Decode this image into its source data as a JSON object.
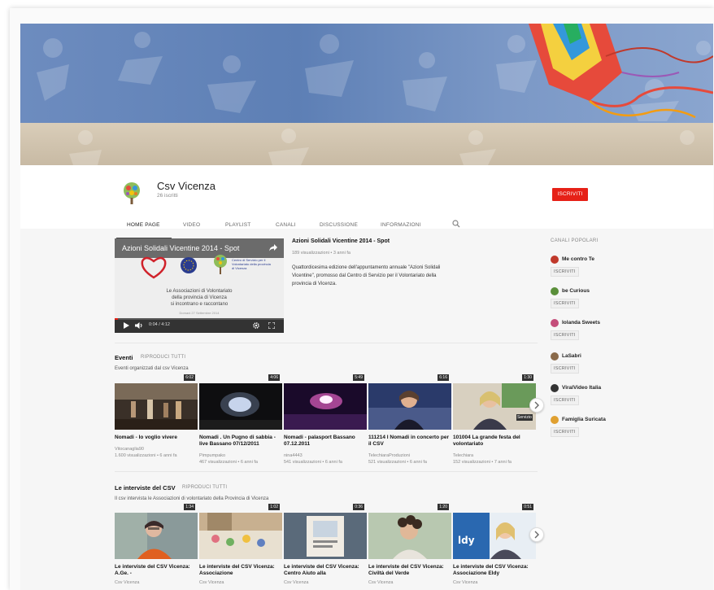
{
  "channel": {
    "name": "Csv Vicenza",
    "subscribers": "26 iscritti",
    "subscribe_label": "ISCRIVITI"
  },
  "tabs": [
    {
      "label": "HOME PAGE",
      "active": true
    },
    {
      "label": "VIDEO"
    },
    {
      "label": "PLAYLIST"
    },
    {
      "label": "CANALI"
    },
    {
      "label": "DISCUSSIONE"
    },
    {
      "label": "INFORMAZIONI"
    }
  ],
  "featured": {
    "player_title": "Azioni Solidali Vicentine 2014 - Spot",
    "player_text": [
      "Le Associazioni di Volontariato",
      "della provincia di Vicenza",
      "si incontrano e raccontano"
    ],
    "player_date": "Domani 27 Settembre 2014",
    "logo_text": "Centro di Servizio per il Volontariato della provincia di Vicenza",
    "time": "0:04 / 4:12",
    "title": "Azioni Solidali Vicentine 2014 - Spot",
    "meta": "189 visualizzazioni • 3 anni fa",
    "description": "Quattordicesima edizione dell'appuntamento annuale \"Azioni Solidali Vicentine\", promosso dal Centro di Servizio per il Volontariato della provincia di Vicenza."
  },
  "shelves": [
    {
      "title": "Eventi",
      "play_all": "RIPRODUCI TUTTI",
      "description": "Eventi organizzati dal csv Vicenza",
      "videos": [
        {
          "title": "Nomadi - Io voglio vivere",
          "channel": "Vitocanaglia90",
          "meta": "1.600 visualizzazioni • 6 anni fa",
          "duration": "6:02",
          "thumb": "concert-stage"
        },
        {
          "title": "Nomadi . Un Pugno di sabbia - live Bassano 07/12/2011",
          "channel": "Pimpumpako",
          "meta": "467 visualizzazioni • 6 anni fa",
          "duration": "4:06",
          "thumb": "dark-stage"
        },
        {
          "title": "Nomadi - palasport Bassano 07.12.2011",
          "channel": "nina4443",
          "meta": "541 visualizzazioni • 6 anni fa",
          "duration": "5:49",
          "thumb": "arena-lights"
        },
        {
          "title": "111214 I Nomadi in concerto per il CSV",
          "channel": "TelechiaraProduzioni",
          "meta": "521 visualizzazioni • 6 anni fa",
          "duration": "6:16",
          "thumb": "interview-woman"
        },
        {
          "title": "101004 La grande festa del volontariato",
          "channel": "Telechiara",
          "meta": "152 visualizzazioni • 7 anni fa",
          "duration": "1:30",
          "thumb": "interview-blonde",
          "badge": "Servizio"
        }
      ]
    },
    {
      "title": "Le interviste del CSV",
      "play_all": "RIPRODUCI TUTTI",
      "description": "Il csv intervista le Associazioni di volontariato della Provincia di Vicenza",
      "videos": [
        {
          "title": "Le interviste del CSV Vicenza: A.Ge. -",
          "channel": "Csv Vicenza",
          "duration": "1:34",
          "thumb": "interview-glasses"
        },
        {
          "title": "Le interviste del CSV Vicenza: Associazione",
          "channel": "Csv Vicenza",
          "duration": "1:02",
          "thumb": "market-table"
        },
        {
          "title": "Le interviste del CSV Vicenza: Centro Aiuto alla",
          "channel": "Csv Vicenza",
          "duration": "0:36",
          "thumb": "poster"
        },
        {
          "title": "Le interviste del CSV Vicenza: Civiltà del Verde",
          "channel": "Csv Vicenza",
          "duration": "1:20",
          "thumb": "interview-curly"
        },
        {
          "title": "Le interviste del CSV Vicenza: Associazione Eldy",
          "channel": "Csv Vicenza",
          "duration": "0:51",
          "thumb": "eldy"
        }
      ]
    }
  ],
  "sidebar": {
    "heading": "CANALI POPOLARI",
    "subscribe_label": "ISCRIVITI",
    "channels": [
      {
        "name": "Me contro Te",
        "color": "#c0392b"
      },
      {
        "name": "be Curious",
        "color": "#5a8f3a"
      },
      {
        "name": "Iolanda Sweets",
        "color": "#c44d7a"
      },
      {
        "name": "LaSabri",
        "color": "#8a6a4a"
      },
      {
        "name": "ViralVideo Italia",
        "color": "#333333"
      },
      {
        "name": "Famiglia Suricata",
        "color": "#e0a030"
      }
    ]
  }
}
